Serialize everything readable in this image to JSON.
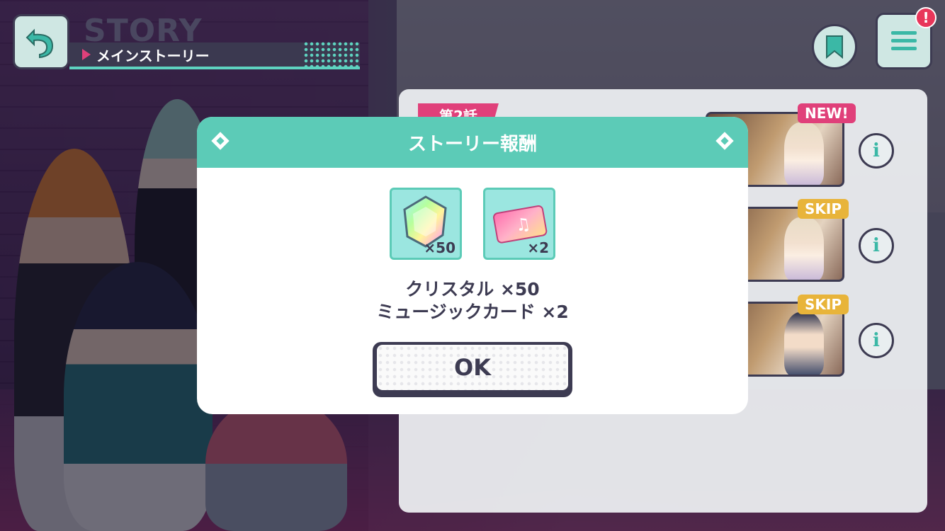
{
  "header": {
    "title": "STORY",
    "subtitle": "メインストーリー",
    "notification_badge": "!"
  },
  "episodes": {
    "tag": "第2話",
    "rows": [
      {
        "badge": "NEW!",
        "info": "i"
      },
      {
        "badge": "SKIP",
        "info": "i"
      },
      {
        "badge": "SKIP",
        "info": "i"
      }
    ]
  },
  "modal": {
    "title": "ストーリー報酬",
    "items": [
      {
        "icon": "crystal-icon",
        "qty": "×50"
      },
      {
        "icon": "music-card-icon",
        "qty": "×2"
      }
    ],
    "lines": [
      "クリスタル ×50",
      "ミュージックカード ×2"
    ],
    "ok_label": "OK"
  },
  "colors": {
    "accent": "#5ccbb7",
    "pink": "#e0407a",
    "dark": "#3d3b52",
    "skip": "#e8b43a"
  }
}
